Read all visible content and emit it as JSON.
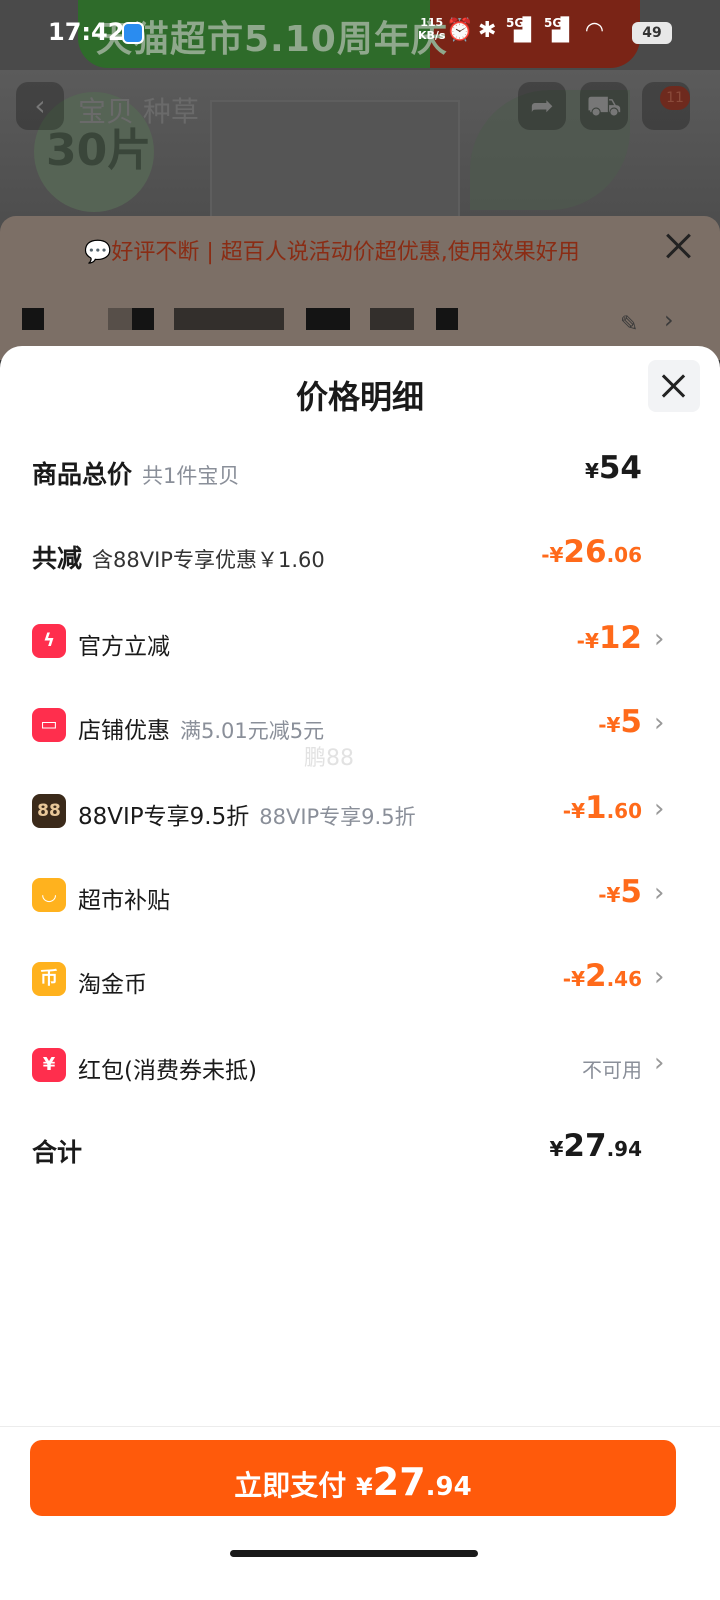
{
  "status_bar": {
    "time": "17:42",
    "net_speed_value": "115",
    "net_speed_unit": "KB/s",
    "signal_1": "5G",
    "signal_2": "5G",
    "battery": "49"
  },
  "background": {
    "banner_text": "天猫超市5.10周年庆",
    "product_badge": "30片",
    "tabs": "宝贝  种草",
    "cart_count": "11",
    "notice": "好评不断 | 超百人说活动价超优惠,使用效果好用"
  },
  "sheet": {
    "title": "价格明细",
    "total_items": {
      "label": "商品总价",
      "sub": "共1件宝贝",
      "currency": "¥",
      "int": "54",
      "dec": ""
    },
    "discount_total": {
      "label": "共减",
      "sub": "含88VIP专享优惠￥1.60",
      "prefix": "-¥",
      "int": "26",
      "dec": ".06"
    },
    "items": [
      {
        "icon": "lightning-icon",
        "icon_color": "#ff2e4d",
        "label": "官方立减",
        "sub": "",
        "prefix": "-¥",
        "int": "12",
        "dec": ""
      },
      {
        "icon": "store-icon",
        "icon_color": "#ff2e4d",
        "label": "店铺优惠",
        "sub": "满5.01元减5元",
        "prefix": "-¥",
        "int": "5",
        "dec": ""
      },
      {
        "icon": "vip88-icon",
        "icon_color": "#3b2a1a",
        "icon_text": "88",
        "label": "88VIP专享9.5折",
        "sub": "88VIP专享9.5折",
        "prefix": "-¥",
        "int": "1",
        "dec": ".60"
      },
      {
        "icon": "supermarket-icon",
        "icon_color": "#ffb21e",
        "label": "超市补贴",
        "sub": "",
        "prefix": "-¥",
        "int": "5",
        "dec": ""
      },
      {
        "icon": "coin-icon",
        "icon_color": "#ffb21e",
        "label": "淘金币",
        "sub": "",
        "prefix": "-¥",
        "int": "2",
        "dec": ".46"
      },
      {
        "icon": "red-packet-icon",
        "icon_color": "#ff2e4d",
        "label": "红包(消费券未抵)",
        "sub": "",
        "status": "不可用"
      }
    ],
    "grand_total": {
      "label": "合计",
      "currency": "¥",
      "int": "27",
      "dec": ".94"
    },
    "watermark": "鹏88"
  },
  "pay_button": {
    "label": "立即支付",
    "currency": "¥",
    "int": "27",
    "dec": ".94"
  },
  "colors": {
    "accent": "#ff5a0b",
    "discount": "#ff6a1a",
    "red_icon": "#ff2e4d",
    "yellow_icon": "#ffb21e"
  }
}
